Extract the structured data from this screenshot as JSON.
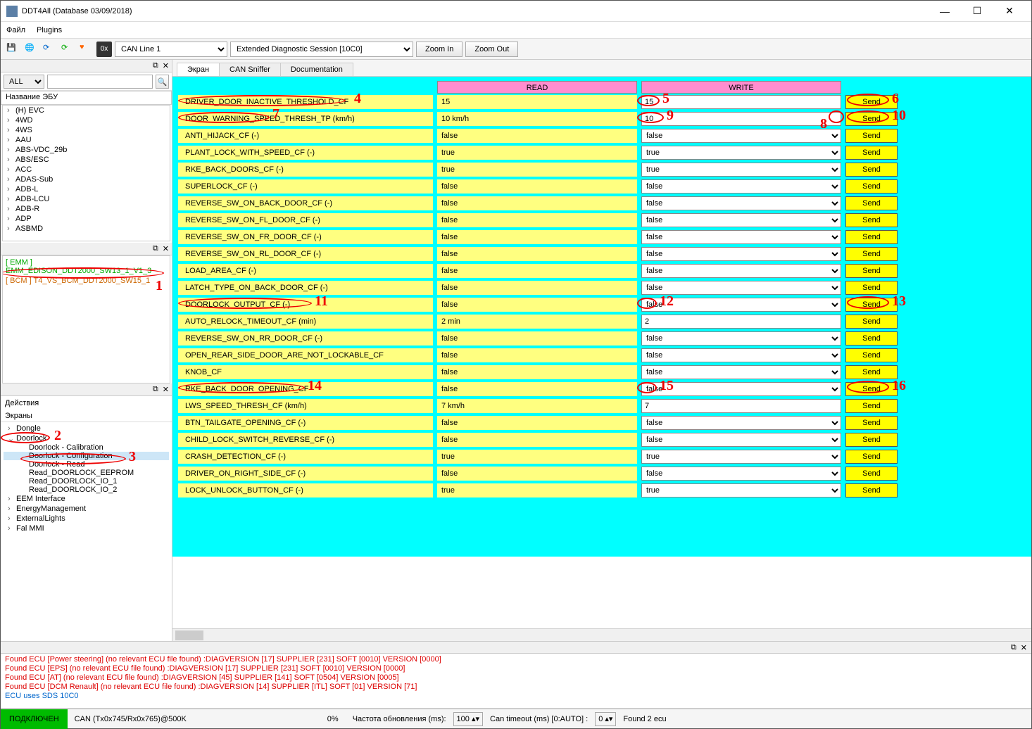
{
  "window": {
    "title": "DDT4All (Database 03/09/2018)"
  },
  "menu": {
    "file": "Файл",
    "plugins": "Plugins"
  },
  "toolbar": {
    "can_line": "CAN Line 1",
    "session": "Extended Diagnostic Session [10C0]",
    "zoom_in": "Zoom In",
    "zoom_out": "Zoom Out",
    "hex": "0x"
  },
  "left": {
    "filter_all": "ALL",
    "ecu_name_hdr": "Название ЭБУ",
    "ecu_tree": [
      "(H) EVC",
      "4WD",
      "4WS",
      "AAU",
      "ABS-VDC_29b",
      "ABS/ESC",
      "ACC",
      "ADAS-Sub",
      "ADB-L",
      "ADB-LCU",
      "ADB-R",
      "ADP",
      "ASBMD"
    ],
    "mid_items": [
      {
        "txt": "[ EMM ] EMM_EDISON_DDT2000_SW13_1_V1_3",
        "cls": "green"
      },
      {
        "txt": "[ BCM ] T4_VS_BCM_DDT2000_SW15_1",
        "cls": "orange"
      }
    ],
    "actions_hdr": "Действия",
    "screens_lbl": "Экраны",
    "tree2": [
      {
        "label": "Dongle",
        "open": false
      },
      {
        "label": "Doorlock",
        "open": true,
        "children": [
          {
            "label": "Doorlock - Calibration"
          },
          {
            "label": "Doorlock - Configuration",
            "sel": true
          },
          {
            "label": "Doorlock - Read"
          },
          {
            "label": "Read_DOORLOCK_EEPROM"
          },
          {
            "label": "Read_DOORLOCK_IO_1"
          },
          {
            "label": "Read_DOORLOCK_IO_2"
          }
        ]
      },
      {
        "label": "EEM Interface",
        "open": false
      },
      {
        "label": "EnergyManagement",
        "open": false
      },
      {
        "label": "ExternalLights",
        "open": false
      },
      {
        "label": "Fal MMI",
        "open": false
      }
    ]
  },
  "tabs": {
    "screen": "Экран",
    "sniffer": "CAN Sniffer",
    "doc": "Documentation"
  },
  "grid": {
    "read_hdr": "READ",
    "write_hdr": "WRITE",
    "send": "Send",
    "rows": [
      {
        "name": "DRIVER_DOOR_INACTIVE_THRESHOLD_CF",
        "read": "15",
        "write": "15",
        "type": "input"
      },
      {
        "name": "DOOR_WARNING_SPEED_THRESH_TP (km/h)",
        "read": "10 km/h",
        "write": "10",
        "type": "input"
      },
      {
        "name": "ANTI_HIJACK_CF (-)",
        "read": "false",
        "write": "false",
        "type": "select"
      },
      {
        "name": "PLANT_LOCK_WITH_SPEED_CF (-)",
        "read": "true",
        "write": "true",
        "type": "select"
      },
      {
        "name": "RKE_BACK_DOORS_CF (-)",
        "read": "true",
        "write": "true",
        "type": "select"
      },
      {
        "name": "SUPERLOCK_CF (-)",
        "read": "false",
        "write": "false",
        "type": "select"
      },
      {
        "name": "REVERSE_SW_ON_BACK_DOOR_CF (-)",
        "read": "false",
        "write": "false",
        "type": "select"
      },
      {
        "name": "REVERSE_SW_ON_FL_DOOR_CF (-)",
        "read": "false",
        "write": "false",
        "type": "select"
      },
      {
        "name": "REVERSE_SW_ON_FR_DOOR_CF (-)",
        "read": "false",
        "write": "false",
        "type": "select"
      },
      {
        "name": "REVERSE_SW_ON_RL_DOOR_CF (-)",
        "read": "false",
        "write": "false",
        "type": "select"
      },
      {
        "name": "LOAD_AREA_CF (-)",
        "read": "false",
        "write": "false",
        "type": "select"
      },
      {
        "name": "LATCH_TYPE_ON_BACK_DOOR_CF (-)",
        "read": "false",
        "write": "false",
        "type": "select"
      },
      {
        "name": "DOORLOCK_OUTPUT_CF (-)",
        "read": "false",
        "write": "false",
        "type": "select"
      },
      {
        "name": "AUTO_RELOCK_TIMEOUT_CF (min)",
        "read": "2 min",
        "write": "2",
        "type": "input"
      },
      {
        "name": "REVERSE_SW_ON_RR_DOOR_CF (-)",
        "read": "false",
        "write": "false",
        "type": "select"
      },
      {
        "name": "OPEN_REAR_SIDE_DOOR_ARE_NOT_LOCKABLE_CF",
        "read": "false",
        "write": "false",
        "type": "select"
      },
      {
        "name": "KNOB_CF",
        "read": "false",
        "write": "false",
        "type": "select"
      },
      {
        "name": "RKE_BACK_DOOR_OPENING_CF",
        "read": "false",
        "write": "false",
        "type": "select"
      },
      {
        "name": "LWS_SPEED_THRESH_CF (km/h)",
        "read": "7 km/h",
        "write": "7",
        "type": "input"
      },
      {
        "name": "BTN_TAILGATE_OPENING_CF (-)",
        "read": "false",
        "write": "false",
        "type": "select"
      },
      {
        "name": "CHILD_LOCK_SWITCH_REVERSE_CF (-)",
        "read": "false",
        "write": "false",
        "type": "select"
      },
      {
        "name": "CRASH_DETECTION_CF (-)",
        "read": "true",
        "write": "true",
        "type": "select"
      },
      {
        "name": "DRIVER_ON_RIGHT_SIDE_CF (-)",
        "read": "false",
        "write": "false",
        "type": "select"
      },
      {
        "name": "LOCK_UNLOCK_BUTTON_CF (-)",
        "read": "true",
        "write": "true",
        "type": "select"
      }
    ]
  },
  "log": [
    {
      "txt": "Found ECU [Power steering]  (no relevant ECU file found) :DIAGVERSION [17] SUPPLIER [231] SOFT [0010] VERSION [0000]",
      "cls": "log-red"
    },
    {
      "txt": "Found ECU [EPS]  (no relevant ECU file found) :DIAGVERSION [17] SUPPLIER [231] SOFT [0010] VERSION [0000]",
      "cls": "log-red"
    },
    {
      "txt": "Found ECU [AT]  (no relevant ECU file found) :DIAGVERSION [45] SUPPLIER [141] SOFT [0504] VERSION [0005]",
      "cls": "log-red"
    },
    {
      "txt": "Found ECU [DCM Renault]  (no relevant ECU file found) :DIAGVERSION [14] SUPPLIER [ITL] SOFT [01] VERSION [71]",
      "cls": "log-red"
    },
    {
      "txt": "ECU uses SDS 10C0",
      "cls": "log-blue"
    }
  ],
  "status": {
    "connected": "ПОДКЛЮЧЕН",
    "can": "CAN (Tx0x745/Rx0x765)@500K",
    "pct": "0%",
    "refresh_lbl": "Частота обновления (ms):",
    "refresh_val": "100",
    "timeout_lbl": "Can timeout (ms) [0:AUTO] :",
    "timeout_val": "0",
    "found": "Found 2 ecu"
  },
  "annotations": {
    "1": "1",
    "2": "2",
    "3": "3",
    "4": "4",
    "5": "5",
    "6": "6",
    "7": "7",
    "8": "8",
    "9": "9",
    "10": "10",
    "11": "11",
    "12": "12",
    "13": "13",
    "14": "14",
    "15": "15",
    "16": "16"
  }
}
